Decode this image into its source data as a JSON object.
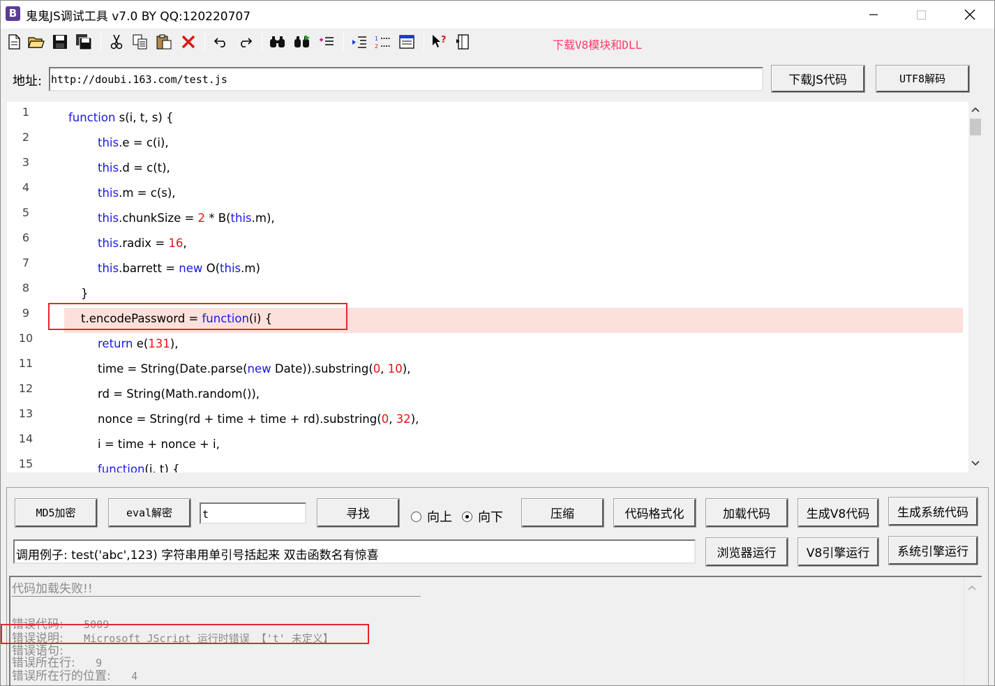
{
  "window": {
    "title": "鬼鬼JS调试工具 v7.0 BY QQ:120220707",
    "icon_letter": "B",
    "icon_color": "#5b3d99"
  },
  "toolbar": {
    "icons": [
      "new-file-icon",
      "open-folder-icon",
      "save-icon",
      "save-all-icon",
      "cut-icon",
      "copy-icon",
      "paste-icon",
      "delete-icon",
      "undo-icon",
      "redo-icon",
      "find-icon",
      "find-next-icon",
      "replace-icon",
      "indent-icon",
      "line-numbers-icon",
      "window-icon",
      "help-icon",
      "panel-icon"
    ],
    "download_link": "下载V8模块和DLL",
    "download_link_color": "#ff3b6b"
  },
  "address": {
    "label": "地址:",
    "url": "http://doubi.163.com/test.js",
    "download_button": "下载JS代码",
    "utf8_button": "UTF8解码"
  },
  "editor": {
    "keyword_color": "#1a18e6",
    "number_color": "#ee1111",
    "highlight_color": "#fbe0db",
    "line_numbers": [
      "1",
      "2",
      "3",
      "4",
      "5",
      "6",
      "7",
      "8",
      "9",
      "10",
      "11",
      "12",
      "13",
      "14",
      "15"
    ],
    "lines": [
      {
        "indent": 0,
        "parts": [
          [
            "kw",
            "function"
          ],
          [
            "t",
            " s(i, t, s) {"
          ]
        ]
      },
      {
        "indent": 2,
        "parts": [
          [
            "kw",
            "this"
          ],
          [
            "t",
            ".e = c(i),"
          ]
        ]
      },
      {
        "indent": 2,
        "parts": [
          [
            "kw",
            "this"
          ],
          [
            "t",
            ".d = c(t),"
          ]
        ]
      },
      {
        "indent": 2,
        "parts": [
          [
            "kw",
            "this"
          ],
          [
            "t",
            ".m = c(s),"
          ]
        ]
      },
      {
        "indent": 2,
        "parts": [
          [
            "kw",
            "this"
          ],
          [
            "t",
            ".chunkSize = "
          ],
          [
            "num",
            "2"
          ],
          [
            "t",
            " * B("
          ],
          [
            "kw",
            "this"
          ],
          [
            "t",
            ".m),"
          ]
        ]
      },
      {
        "indent": 2,
        "parts": [
          [
            "kw",
            "this"
          ],
          [
            "t",
            ".radix = "
          ],
          [
            "num",
            "16"
          ],
          [
            "t",
            ","
          ]
        ]
      },
      {
        "indent": 2,
        "parts": [
          [
            "kw",
            "this"
          ],
          [
            "t",
            ".barrett = "
          ],
          [
            "kw",
            "new"
          ],
          [
            "t",
            " O("
          ],
          [
            "kw",
            "this"
          ],
          [
            "t",
            ".m)"
          ]
        ]
      },
      {
        "indent": 1,
        "parts": [
          [
            "t",
            "}"
          ]
        ]
      },
      {
        "indent": 1,
        "parts": [
          [
            "t",
            "t.encodePassword = "
          ],
          [
            "kw",
            "function"
          ],
          [
            "t",
            "(i) {"
          ]
        ]
      },
      {
        "indent": 2,
        "parts": [
          [
            "kw",
            "return"
          ],
          [
            "t",
            " e("
          ],
          [
            "num",
            "131"
          ],
          [
            "t",
            "),"
          ]
        ]
      },
      {
        "indent": 2,
        "parts": [
          [
            "t",
            "time = String(Date.parse("
          ],
          [
            "kw",
            "new"
          ],
          [
            "t",
            " Date)).substring("
          ],
          [
            "num",
            "0"
          ],
          [
            "t",
            ", "
          ],
          [
            "num",
            "10"
          ],
          [
            "t",
            "),"
          ]
        ]
      },
      {
        "indent": 2,
        "parts": [
          [
            "t",
            "rd = String(Math.random()),"
          ]
        ]
      },
      {
        "indent": 2,
        "parts": [
          [
            "t",
            "nonce = String(rd + time + time + rd).substring("
          ],
          [
            "num",
            "0"
          ],
          [
            "t",
            ", "
          ],
          [
            "num",
            "32"
          ],
          [
            "t",
            "),"
          ]
        ]
      },
      {
        "indent": 2,
        "parts": [
          [
            "t",
            "i = time + nonce + i,"
          ]
        ]
      },
      {
        "indent": 2,
        "parts": [
          [
            "kw",
            "function"
          ],
          [
            "t",
            "(i, t) {"
          ]
        ]
      }
    ]
  },
  "controls": {
    "md5_button": "MD5加密",
    "eval_button": "eval解密",
    "search_value": "t",
    "find_button": "寻找",
    "radio_up": "向上",
    "radio_down": "向下",
    "radio_selected": "向下",
    "compress_button": "压缩",
    "format_button": "代码格式化",
    "load_button": "加载代码",
    "gen_v8_button": "生成V8代码",
    "gen_sys_button": "生成系统代码",
    "call_example": "调用例子: test('abc',123) 字符串用单引号括起来 双击函数名有惊喜",
    "browser_run_button": "浏览器运行",
    "v8_run_button": "V8引擎运行",
    "sys_run_button": "系统引擎运行"
  },
  "output": {
    "header": "代码加载失败!!",
    "error_code_label": "错误代码:",
    "error_code": "5009",
    "error_desc_label": "错误说明:",
    "error_desc": "Microsoft JScript 运行时错误 【't' 未定义】",
    "error_stmt_label": "错误语句:",
    "error_line_label": "错误所在行:",
    "error_line": "9",
    "error_pos_label": "错误所在行的位置:",
    "error_pos": "4"
  },
  "annotation_color": "#e8262c"
}
